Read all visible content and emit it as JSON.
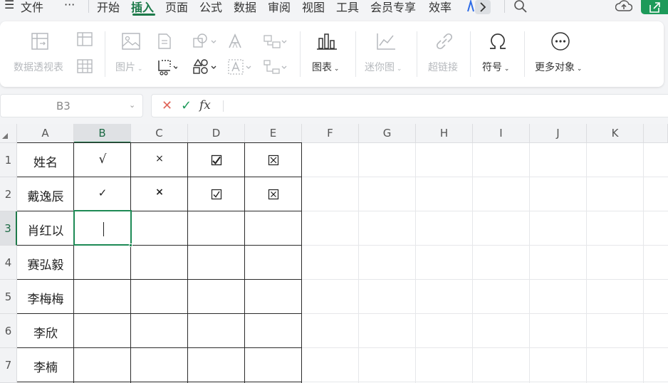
{
  "menubar": {
    "file_label": "文件",
    "more_label": "···",
    "tabs": [
      "开始",
      "插入",
      "页面",
      "公式",
      "数据",
      "审阅",
      "视图",
      "工具",
      "会员专享",
      "效率"
    ]
  },
  "ribbon": {
    "pivot_table": "数据透视表",
    "picture": "图片",
    "chart": "图表",
    "sparkline": "迷你图",
    "hyperlink": "超链接",
    "symbol": "符号",
    "more_objects": "更多对象"
  },
  "formula_bar": {
    "cell_ref": "B3",
    "formula": ""
  },
  "sheet": {
    "columns": [
      "A",
      "B",
      "C",
      "D",
      "E",
      "F",
      "G",
      "H",
      "I",
      "J",
      "K"
    ],
    "rows": [
      "1",
      "2",
      "3",
      "4",
      "5",
      "6",
      "7"
    ],
    "cells": {
      "A1": "姓名",
      "B1": "√",
      "C1": "×",
      "D1": "🗹",
      "E1": "⊠",
      "A2": "戴逸辰",
      "B2": "✓",
      "C2": "×",
      "D2": "☑",
      "E2": "☒",
      "A3": "肖红以",
      "A4": "赛弘毅",
      "A5": "李梅梅",
      "A6": "李欣",
      "A7": "李楠"
    },
    "selected_cell": "B3"
  },
  "colors": {
    "accent": "#1d7a4a",
    "selection": "#1d8a55"
  }
}
